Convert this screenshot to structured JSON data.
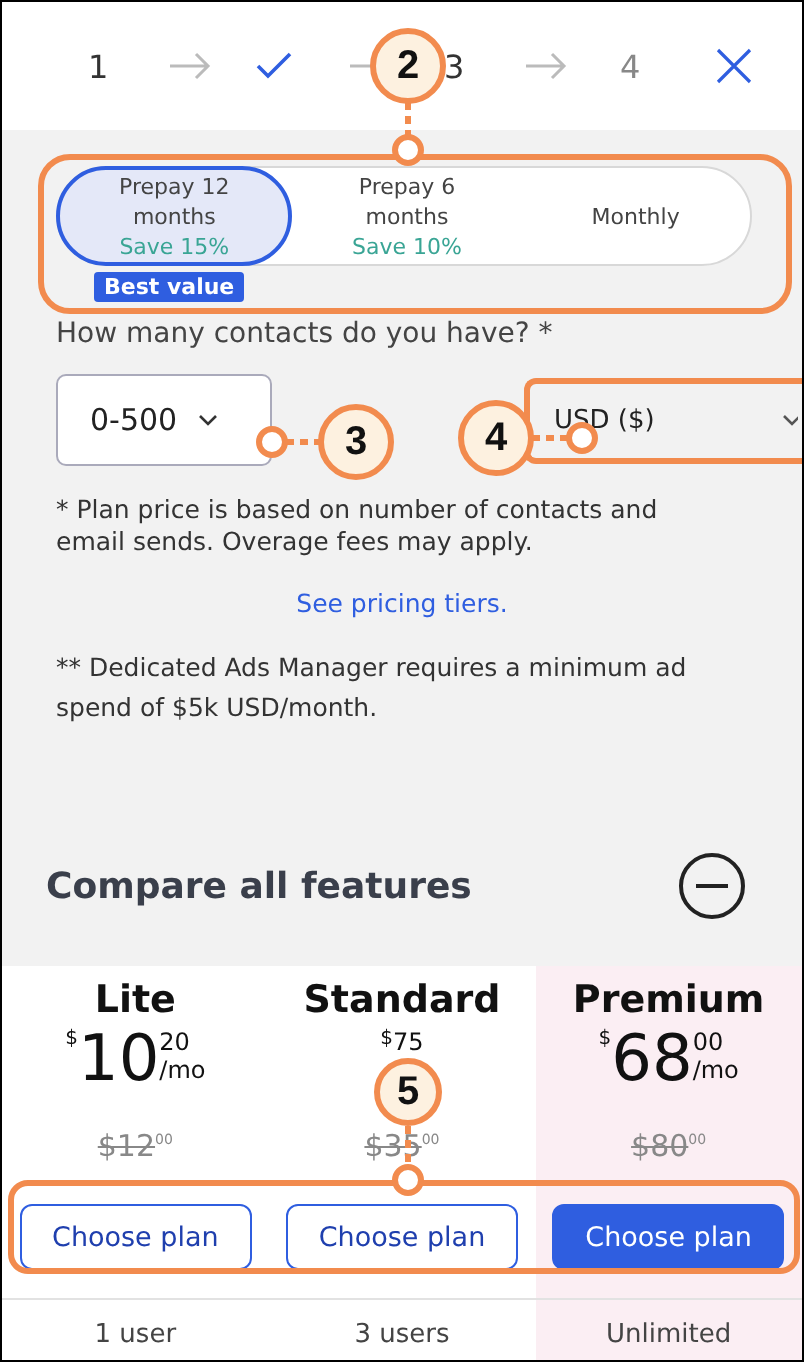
{
  "stepper": {
    "steps": [
      {
        "kind": "number",
        "label": "1"
      },
      {
        "kind": "done"
      },
      {
        "kind": "number",
        "label": "3"
      },
      {
        "kind": "number",
        "label": "4"
      }
    ]
  },
  "billing": [
    {
      "label": "Prepay 12 months",
      "saving": "Save 15%",
      "badge": "Best value",
      "selected": true
    },
    {
      "label": "Prepay 6 months",
      "saving": "Save 10%",
      "selected": false
    },
    {
      "label": "Monthly",
      "selected": false
    }
  ],
  "contacts": {
    "question": "How many contacts do you have? *",
    "value": "0-500"
  },
  "currency": {
    "value": "USD ($)"
  },
  "note": "* Plan price is based on number of contacts and email sends. Overage fees may apply.",
  "link": "See pricing tiers.",
  "note2": "** Dedicated Ads Manager requires a minimum ad spend of $5k USD/month.",
  "compare": {
    "title": "Compare all features",
    "expanded": true
  },
  "plans": [
    {
      "name": "Lite",
      "currency": "$",
      "dollars": "10",
      "cents": "20",
      "per": "/mo",
      "old_price": "$12",
      "old_cents": "00",
      "button": "Choose plan",
      "primary": false,
      "highlighted": false,
      "users": "1 user"
    },
    {
      "name": "Standard",
      "currency": "$",
      "cents": "75",
      "old_price": "$35",
      "old_cents": "00",
      "button": "Choose plan",
      "primary": false,
      "highlighted": false,
      "users": "3 users"
    },
    {
      "name": "Premium",
      "currency": "$",
      "dollars": "68",
      "cents": "00",
      "per": "/mo",
      "old_price": "$80",
      "old_cents": "00",
      "button": "Choose plan",
      "primary": true,
      "highlighted": true,
      "users": "Unlimited"
    }
  ],
  "callouts": [
    {
      "number": "2"
    },
    {
      "number": "3"
    },
    {
      "number": "4"
    },
    {
      "number": "5"
    }
  ]
}
